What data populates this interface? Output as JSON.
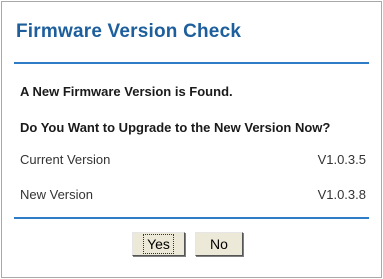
{
  "header": {
    "title": "Firmware Version Check"
  },
  "message": {
    "found": "A New Firmware Version is Found.",
    "question": "Do You Want to Upgrade to the New Version Now?"
  },
  "versions": {
    "current_label": "Current Version",
    "current_value": "V1.0.3.5",
    "new_label": "New Version",
    "new_value": "V1.0.3.8"
  },
  "actions": {
    "yes_label": "Yes",
    "no_label": "No"
  },
  "colors": {
    "title": "#1d5e9c",
    "rule": "#2e7cc8",
    "button_face": "#ece9d8"
  }
}
